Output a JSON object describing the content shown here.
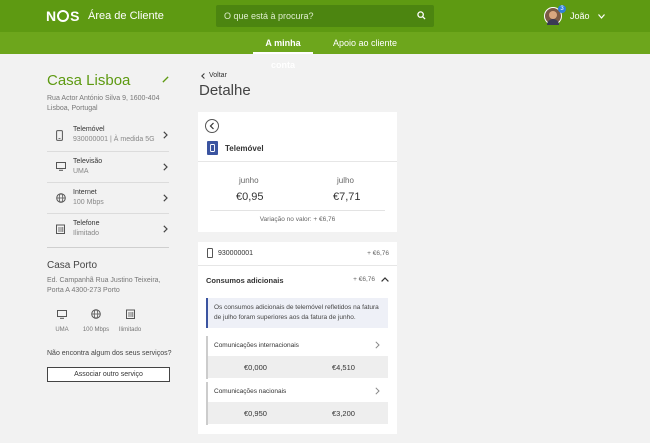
{
  "header": {
    "logo_text": "NOS",
    "app_title": "Área de Cliente",
    "search_placeholder": "O que está à procura?",
    "user_name": "João",
    "notification_count": "3",
    "brand_color": "#5e9a12"
  },
  "nav": {
    "tabs": [
      {
        "label": "A minha conta",
        "active": true
      },
      {
        "label": "Apoio ao cliente",
        "active": false
      }
    ]
  },
  "sidebar": {
    "home1": {
      "name": "Casa Lisboa",
      "address": "Rua Actor António Silva 9, 1600-404 Lisboa, Portugal",
      "services": [
        {
          "title": "Telemóvel",
          "subtitle": "930000001 | À medida 5G",
          "icon": "mobile-icon"
        },
        {
          "title": "Televisão",
          "subtitle": "UMA",
          "icon": "tv-icon"
        },
        {
          "title": "Internet",
          "subtitle": "100 Mbps",
          "icon": "globe-icon"
        },
        {
          "title": "Telefone",
          "subtitle": "Ilimitado",
          "icon": "landline-icon"
        }
      ]
    },
    "home2": {
      "name": "Casa Porto",
      "address": "Ed. Campanhã Rua Justino Teixeira, Porta A 4300-273 Porto",
      "mini_services": [
        {
          "label": "UMA",
          "icon": "tv-icon"
        },
        {
          "label": "100 Mbps",
          "icon": "globe-icon"
        },
        {
          "label": "Ilimitado",
          "icon": "landline-icon"
        }
      ]
    },
    "question": "Não encontra algum dos seus serviços?",
    "associate_button": "Associar outro serviço"
  },
  "main": {
    "back_label": "Voltar",
    "title": "Detalhe",
    "card": {
      "service": "Telemóvel",
      "months": [
        {
          "month": "junho",
          "amount": "€0,95"
        },
        {
          "month": "julho",
          "amount": "€7,71"
        }
      ],
      "variation": "Variação no valor: + €6,76"
    },
    "detail": {
      "number": "930000001",
      "number_value": "+ €6,76",
      "consumos_title": "Consumos adicionais",
      "consumos_value": "+ €6,76",
      "info": "Os consumos adicionais de telemóvel refletidos na fatura de julho foram superiores aos da fatura de junho.",
      "items": [
        {
          "label": "Comunicações internacionais",
          "june": "€0,000",
          "july": "€4,510"
        },
        {
          "label": "Comunicações nacionais",
          "june": "€0,950",
          "july": "€3,200"
        }
      ]
    }
  }
}
